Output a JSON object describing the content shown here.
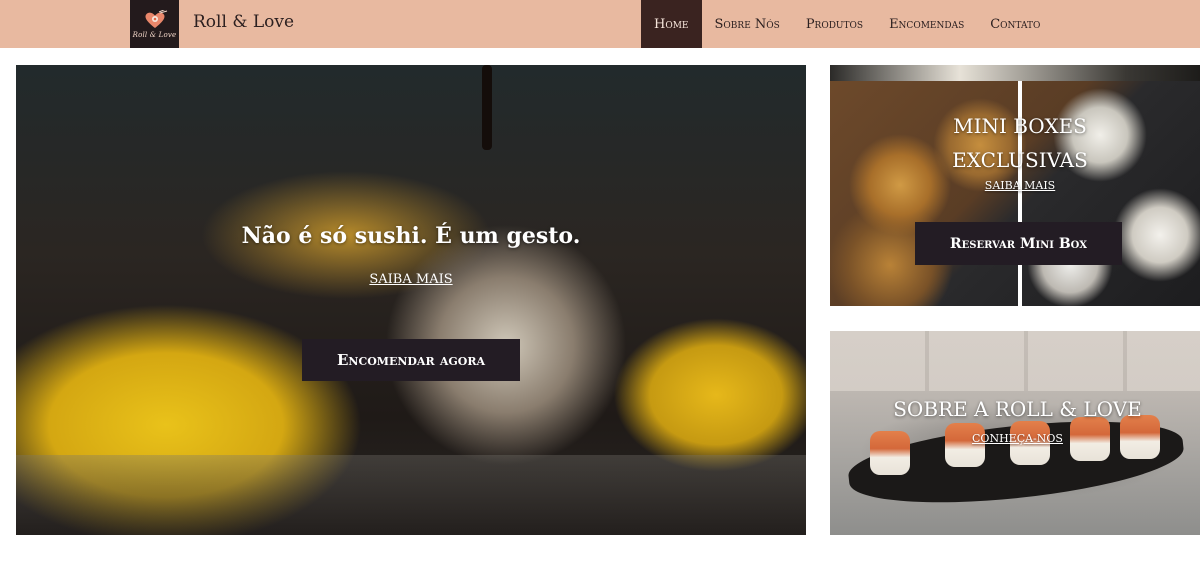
{
  "header": {
    "logo_text": "Roll & Love",
    "brand_name": "Roll & Love",
    "nav": [
      {
        "label": "Home",
        "active": true
      },
      {
        "label": "Sobre Nós",
        "active": false
      },
      {
        "label": "Produtos",
        "active": false
      },
      {
        "label": "Encomendas",
        "active": false
      },
      {
        "label": "Contato",
        "active": false
      }
    ]
  },
  "hero": {
    "title": "Não é só sushi. É um gesto.",
    "link": "SAIBA MAIS",
    "button": "Encomendar agora"
  },
  "mini_boxes": {
    "title_line1": "MINI BOXES",
    "title_line2": "EXCLUSIVAS",
    "link": "SAIBA MAIS",
    "button": "Reservar Mini Box"
  },
  "about": {
    "title": "SOBRE A ROLL & LOVE",
    "link": "CONHEÇA-NOS"
  },
  "colors": {
    "header_bg": "#e8b9a0",
    "nav_active_bg": "#3a2320",
    "button_bg": "#231c24",
    "logo_bg": "#231a1c"
  },
  "icons": {
    "logo": "heart-sushi-logo-icon"
  }
}
